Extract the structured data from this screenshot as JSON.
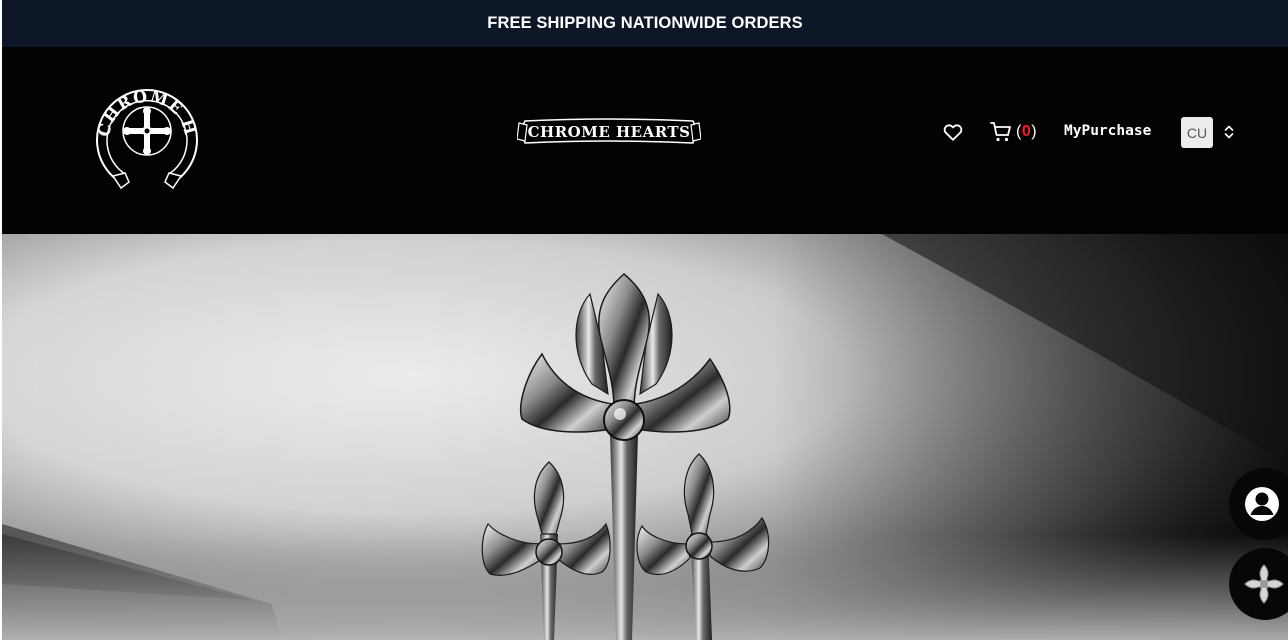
{
  "announcement": {
    "text": "FREE SHIPPING NATIONWIDE ORDERS"
  },
  "brand": {
    "emblem_text": "CHROME HEARTS",
    "wordmark_text": "CHROME HEARTS"
  },
  "header": {
    "wishlist_icon": "heart-outline-icon",
    "cart_icon": "shopping-cart-icon",
    "cart_count_open": "(",
    "cart_count": "0",
    "cart_count_close": ")",
    "mypurchase_label": "MyPurchase",
    "currency_code": "CU",
    "currency_arrows_icon": "chevron-up-down-icon"
  },
  "hero": {
    "image": "silver-triple-cross-pendant-photo"
  },
  "floating": {
    "account_icon": "account-circle-icon",
    "cross_icon": "chrome-hearts-cross-icon"
  },
  "colors": {
    "announcement_bg": "#0e1728",
    "header_bg": "#030303",
    "cart_count": "#ff1a1a",
    "currency_bg": "#ececec"
  }
}
